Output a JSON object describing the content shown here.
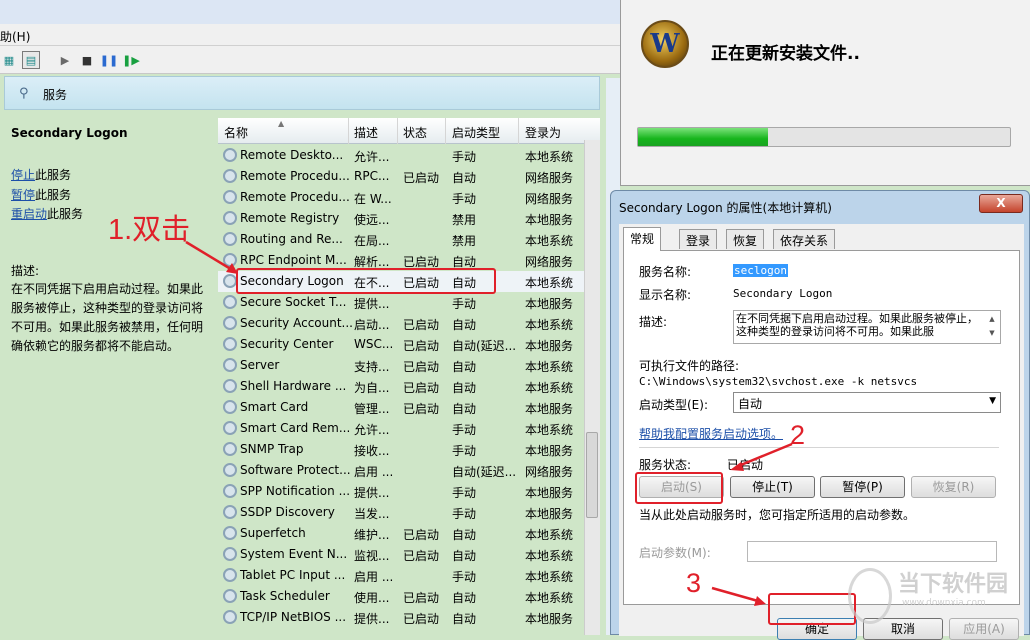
{
  "menubar": {
    "help_label": "助(H)"
  },
  "toolbar": {
    "icons": [
      "console-tree-icon",
      "properties-icon",
      "play-icon",
      "stop-icon",
      "pause-icon",
      "resume-icon"
    ]
  },
  "services_header": {
    "label": "服务"
  },
  "left_pane": {
    "title": "Secondary Logon",
    "stop_link": "停止",
    "stop_suffix": "此服务",
    "pause_link": "暂停",
    "pause_suffix": "此服务",
    "restart_link": "重启动",
    "restart_suffix": "此服务",
    "desc_label": "描述:",
    "desc_text": "在不同凭据下启用启动过程。如果此服务被停止，这种类型的登录访问将不可用。如果此服务被禁用，任何明确依赖它的服务都将不能启动。"
  },
  "columns": [
    "名称",
    "描述",
    "状态",
    "启动类型",
    "登录为"
  ],
  "rows": [
    {
      "name": "Remote Deskto...",
      "desc": "允许...",
      "status": "",
      "startup": "手动",
      "logon": "本地系统"
    },
    {
      "name": "Remote Procedu...",
      "desc": "RPC...",
      "status": "已启动",
      "startup": "自动",
      "logon": "网络服务"
    },
    {
      "name": "Remote Procedu...",
      "desc": "在 W...",
      "status": "",
      "startup": "手动",
      "logon": "网络服务"
    },
    {
      "name": "Remote Registry",
      "desc": "使远...",
      "status": "",
      "startup": "禁用",
      "logon": "本地服务"
    },
    {
      "name": "Routing and Re...",
      "desc": "在局...",
      "status": "",
      "startup": "禁用",
      "logon": "本地系统"
    },
    {
      "name": "RPC Endpoint M...",
      "desc": "解析...",
      "status": "已启动",
      "startup": "自动",
      "logon": "网络服务"
    },
    {
      "name": "Secondary Logon",
      "desc": "在不...",
      "status": "已启动",
      "startup": "自动",
      "logon": "本地系统"
    },
    {
      "name": "Secure Socket T...",
      "desc": "提供...",
      "status": "",
      "startup": "手动",
      "logon": "本地服务"
    },
    {
      "name": "Security Account...",
      "desc": "启动...",
      "status": "已启动",
      "startup": "自动",
      "logon": "本地系统"
    },
    {
      "name": "Security Center",
      "desc": "WSC...",
      "status": "已启动",
      "startup": "自动(延迟...",
      "logon": "本地服务"
    },
    {
      "name": "Server",
      "desc": "支持...",
      "status": "已启动",
      "startup": "自动",
      "logon": "本地系统"
    },
    {
      "name": "Shell Hardware ...",
      "desc": "为自...",
      "status": "已启动",
      "startup": "自动",
      "logon": "本地系统"
    },
    {
      "name": "Smart Card",
      "desc": "管理...",
      "status": "已启动",
      "startup": "自动",
      "logon": "本地服务"
    },
    {
      "name": "Smart Card Rem...",
      "desc": "允许...",
      "status": "",
      "startup": "手动",
      "logon": "本地系统"
    },
    {
      "name": "SNMP Trap",
      "desc": "接收...",
      "status": "",
      "startup": "手动",
      "logon": "本地服务"
    },
    {
      "name": "Software Protect...",
      "desc": "启用 ...",
      "status": "",
      "startup": "自动(延迟...",
      "logon": "网络服务"
    },
    {
      "name": "SPP Notification ...",
      "desc": "提供...",
      "status": "",
      "startup": "手动",
      "logon": "本地服务"
    },
    {
      "name": "SSDP Discovery",
      "desc": "当发...",
      "status": "",
      "startup": "手动",
      "logon": "本地服务"
    },
    {
      "name": "Superfetch",
      "desc": "维护...",
      "status": "已启动",
      "startup": "自动",
      "logon": "本地系统"
    },
    {
      "name": "System Event N...",
      "desc": "监视...",
      "status": "已启动",
      "startup": "自动",
      "logon": "本地系统"
    },
    {
      "name": "Tablet PC Input ...",
      "desc": "启用 ...",
      "status": "",
      "startup": "手动",
      "logon": "本地系统"
    },
    {
      "name": "Task Scheduler",
      "desc": "使用...",
      "status": "已启动",
      "startup": "自动",
      "logon": "本地系统"
    },
    {
      "name": "TCP/IP NetBIOS ...",
      "desc": "提供...",
      "status": "已启动",
      "startup": "自动",
      "logon": "本地服务"
    }
  ],
  "annotations": {
    "step1": "1.双击",
    "step2": "2",
    "step3": "3"
  },
  "update_window": {
    "title": "正在更新安装文件..",
    "logo_letter": "W",
    "progress": 0.35
  },
  "dialog": {
    "title": "Secondary Logon 的属性(本地计算机)",
    "close": "X",
    "tabs": [
      "常规",
      "登录",
      "恢复",
      "依存关系"
    ],
    "service_name_label": "服务名称:",
    "service_name_value": "seclogon",
    "display_name_label": "显示名称:",
    "display_name_value": "Secondary Logon",
    "desc_label": "描述:",
    "desc_value": "在不同凭据下启用启动过程。如果此服务被停止，这种类型的登录访问将不可用。如果此服",
    "exe_path_label": "可执行文件的路径:",
    "exe_path_value": "C:\\Windows\\system32\\svchost.exe -k netsvcs",
    "startup_type_label": "启动类型(E):",
    "startup_type_value": "自动",
    "help_link": "帮助我配置服务启动选项。",
    "service_status_label": "服务状态:",
    "service_status_value": "已启动",
    "start_btn": "启动(S)",
    "stop_btn": "停止(T)",
    "pause_btn": "暂停(P)",
    "resume_btn": "恢复(R)",
    "hint": "当从此处启动服务时，您可指定所适用的启动参数。",
    "params_label": "启动参数(M):",
    "ok_btn": "确定",
    "cancel_btn": "取消",
    "apply_btn": "应用(A)"
  },
  "watermark": {
    "text": "当下软件园",
    "sub": "www.downxia.com"
  },
  "colors": {
    "annotation_red": "#e0202a",
    "grid_bg": "#cfe6c8",
    "progress_green": "#16b51c"
  }
}
